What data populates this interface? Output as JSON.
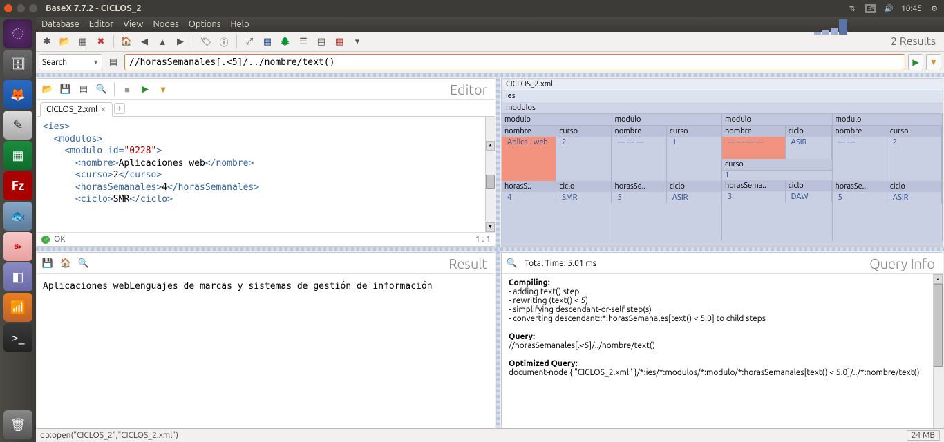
{
  "window": {
    "title": "BaseX 7.7.2 - CICLOS_2",
    "time": "10:45",
    "lang": "Es"
  },
  "menubar": [
    "Database",
    "Editor",
    "View",
    "Nodes",
    "Options",
    "Help"
  ],
  "toolbar": {
    "results": "2 Results"
  },
  "search": {
    "mode": "Search",
    "query": "//horasSemanales[.<5]/../nombre/text()"
  },
  "editor": {
    "title": "Editor",
    "tab": "CICLOS_2.xml",
    "code_html": "<span class='xml-tag'>&lt;ies&gt;</span>\n  <span class='xml-tag'>&lt;modulos&gt;</span>\n    <span class='xml-tag'>&lt;modulo</span> <span class='xml-attr'>id=</span><span class='xml-val'>\"0228\"</span><span class='xml-tag'>&gt;</span>\n      <span class='xml-tag'>&lt;nombre&gt;</span><span class='xml-txt'>Aplicaciones web</span><span class='xml-tag'>&lt;/nombre&gt;</span>\n      <span class='xml-tag'>&lt;curso&gt;</span><span class='xml-txt'>2</span><span class='xml-tag'>&lt;/curso&gt;</span>\n      <span class='xml-tag'>&lt;horasSemanales&gt;</span><span class='xml-txt'>4</span><span class='xml-tag'>&lt;/horasSemanales&gt;</span>\n      <span class='xml-tag'>&lt;ciclo&gt;</span><span class='xml-txt'>SMR</span><span class='xml-tag'>&lt;/ciclo&gt;</span>",
    "status_ok": "OK",
    "linecol": "1 : 1"
  },
  "treemap": {
    "file": "CICLOS_2.xml",
    "root": "ies",
    "child": "modulos",
    "modulos": [
      {
        "nombre": "Aplica.. web",
        "curso": "2",
        "horas": "4",
        "ciclo": "SMR",
        "hl": true
      },
      {
        "nombre": "— — —",
        "curso": "1",
        "horas": "5",
        "ciclo": "ASIR"
      },
      {
        "nombre": "— — — —",
        "curso_top": "1",
        "ciclo_top": "ASIR",
        "horasSemanales": "3",
        "ciclo": "DAW",
        "hl": true
      },
      {
        "nombre": "— —",
        "curso": "2",
        "horas": "5",
        "ciclo": "ASIR"
      }
    ]
  },
  "result": {
    "title": "Result",
    "text": "Aplicaciones webLenguajes de marcas y sistemas de gestión de información"
  },
  "queryinfo": {
    "title": "Query Info",
    "time": "Total Time: 5.01 ms",
    "compiling_hdr": "Compiling:",
    "compiling": [
      "- adding text() step",
      "- rewriting (text() < 5)",
      "- simplifying descendant-or-self step(s)",
      "- converting descendant::*:horasSemanales[text() < 5.0] to child steps"
    ],
    "query_hdr": "Query:",
    "query": "//horasSemanales[.<5]/../nombre/text()",
    "opt_hdr": "Optimized Query:",
    "opt": "document-node { \"CICLOS_2.xml\" }/*:ies/*:modulos/*:modulo/*:horasSemanales[text() < 5.0]/../*:nombre/text()"
  },
  "statusbar": {
    "text": "db:open(\"CICLOS_2\",\"CICLOS_2.xml\")",
    "mem": "24 MB"
  }
}
